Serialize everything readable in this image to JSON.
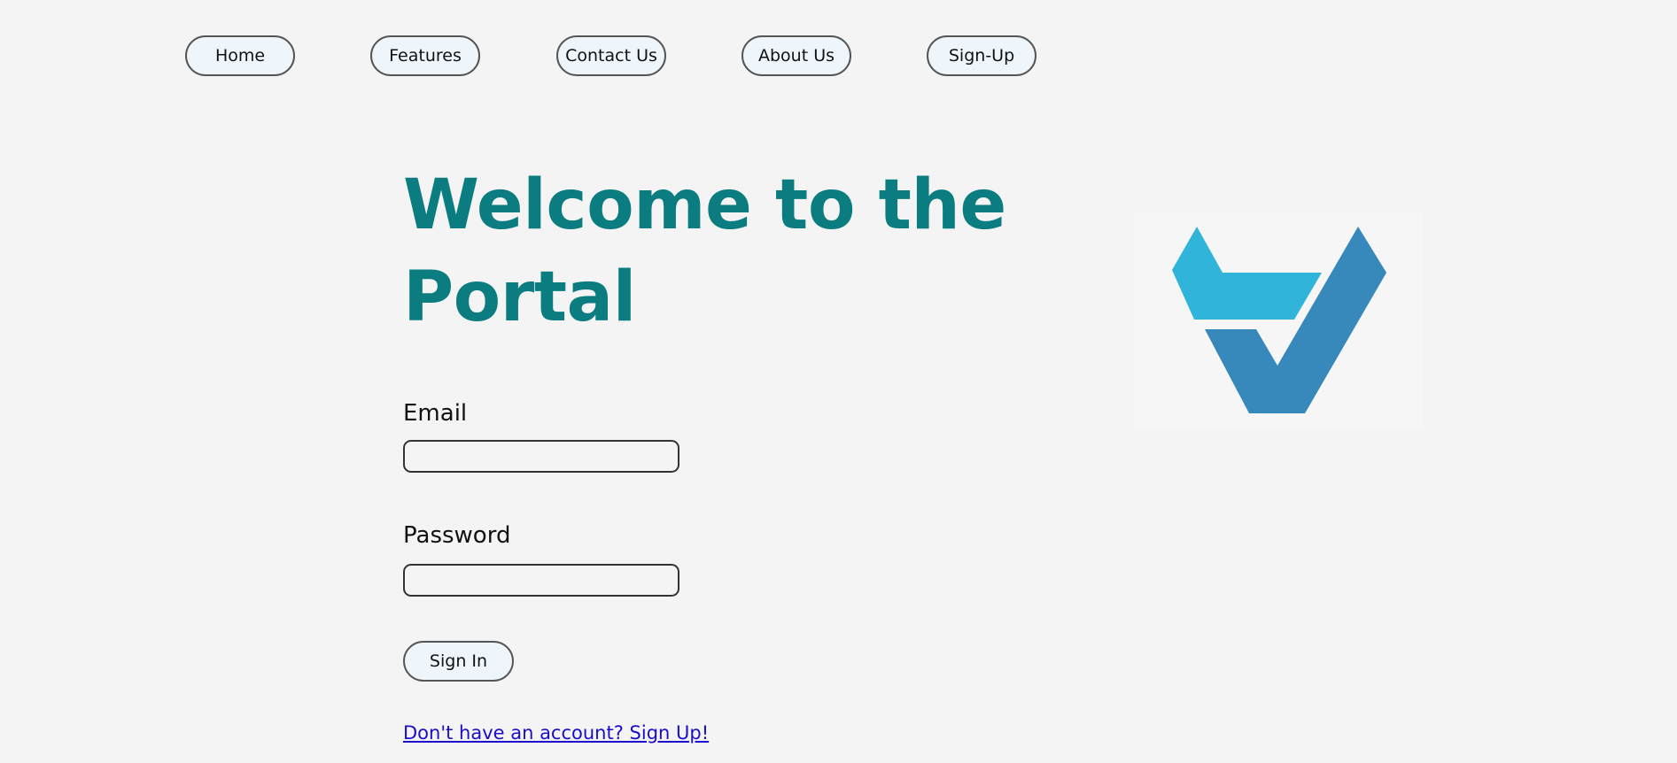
{
  "nav": {
    "items": [
      {
        "label": "Home"
      },
      {
        "label": "Features"
      },
      {
        "label": "Contact Us"
      },
      {
        "label": "About Us"
      },
      {
        "label": "Sign-Up"
      }
    ]
  },
  "main": {
    "headline": "Welcome to the Portal"
  },
  "form": {
    "email_label": "Email",
    "email_value": "",
    "password_label": "Password",
    "password_value": "",
    "signin_label": "Sign In",
    "signup_link": "Don't have an account? Sign Up!"
  },
  "logo": {
    "icon": "v-check-logo-icon",
    "color_light": "#31b4da",
    "color_dark": "#3788bb"
  },
  "colors": {
    "accent": "#0b7d80",
    "link": "#1a0dcc",
    "background": "#f4f4f4",
    "button_bg": "#eef6fc"
  }
}
